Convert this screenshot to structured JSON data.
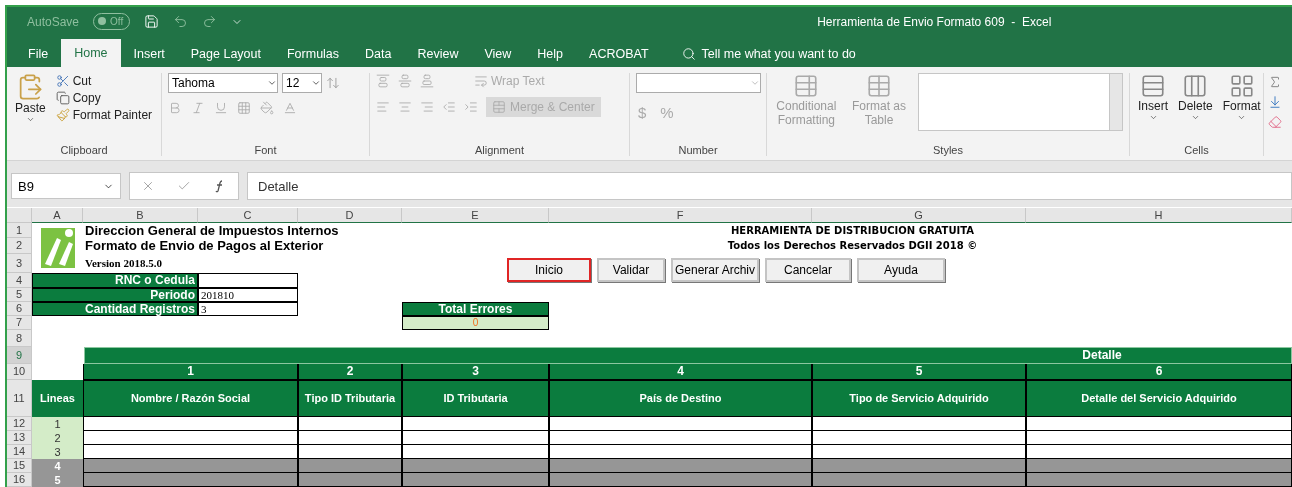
{
  "titlebar": {
    "autosave": {
      "label": "AutoSave",
      "state": "Off",
      "on": false
    },
    "title": "Herramienta de Envio Formato 609  -  Excel"
  },
  "tabs": [
    {
      "label": "File",
      "selected": false
    },
    {
      "label": "Home",
      "selected": true
    },
    {
      "label": "Insert",
      "selected": false
    },
    {
      "label": "Page Layout",
      "selected": false
    },
    {
      "label": "Formulas",
      "selected": false
    },
    {
      "label": "Data",
      "selected": false
    },
    {
      "label": "Review",
      "selected": false
    },
    {
      "label": "View",
      "selected": false
    },
    {
      "label": "Help",
      "selected": false
    },
    {
      "label": "ACROBAT",
      "selected": false
    }
  ],
  "tell_me": "Tell me what you want to do",
  "ribbon": {
    "clipboard": {
      "label": "Clipboard",
      "paste": "Paste",
      "items": [
        {
          "kind": "cut",
          "label": "Cut"
        },
        {
          "kind": "copy",
          "label": "Copy"
        },
        {
          "kind": "painter",
          "label": "Format Painter"
        }
      ]
    },
    "font": {
      "label": "Font",
      "name": "Tahoma",
      "size": "12"
    },
    "alignment": {
      "label": "Alignment",
      "wrap_text": {
        "label": "Wrap Text",
        "disabled": true
      },
      "merge_center": {
        "label": "Merge & Center",
        "disabled": true
      }
    },
    "number": {
      "label": "Number",
      "symbols": [
        "$",
        "%"
      ]
    },
    "styles": {
      "label": "Styles",
      "items": [
        {
          "kind": "conditional",
          "label": "Conditional Formatting",
          "disabled": true
        },
        {
          "kind": "table",
          "label": "Format as Table",
          "disabled": true
        }
      ]
    },
    "cells": {
      "label": "Cells",
      "items": [
        {
          "kind": "insert",
          "label": "Insert"
        },
        {
          "kind": "delete",
          "label": "Delete"
        },
        {
          "kind": "format",
          "label": "Format"
        }
      ]
    }
  },
  "formula_bar": {
    "name_box": "B9",
    "value": "Detalle"
  },
  "column_letters": [
    "A",
    "B",
    "C",
    "D",
    "E",
    "F",
    "G",
    "H"
  ],
  "row_headers": [
    {
      "label": "1",
      "selected": false
    },
    {
      "label": "2",
      "selected": false
    },
    {
      "label": "3",
      "selected": false
    },
    {
      "label": "4",
      "selected": false
    },
    {
      "label": "5",
      "selected": false
    },
    {
      "label": "6",
      "selected": false
    },
    {
      "label": "7",
      "selected": false
    },
    {
      "label": "8",
      "selected": false
    },
    {
      "label": "9",
      "selected": true
    },
    {
      "label": "10",
      "selected": false
    },
    {
      "label": "11",
      "selected": false
    },
    {
      "label": "12",
      "selected": false
    },
    {
      "label": "13",
      "selected": false
    },
    {
      "label": "14",
      "selected": false
    },
    {
      "label": "15",
      "selected": false
    },
    {
      "label": "16",
      "selected": false
    }
  ],
  "sheet": {
    "header_lines": [
      "Direccion General de Impuestos Internos",
      "Formato de Envio de Pagos al Exterior"
    ],
    "version": "Version 2018.5.0",
    "notice": [
      "HERRAMIENTA DE DISTRIBUCION GRATUITA",
      "Todos los Derechos Reservados DGII 2018 ©"
    ],
    "buttons": [
      {
        "label": "Inicio",
        "selected": true
      },
      {
        "label": "Validar",
        "selected": false
      },
      {
        "label": "Generar Archiv",
        "selected": false
      },
      {
        "label": "Cancelar",
        "selected": false
      },
      {
        "label": "Ayuda",
        "selected": false
      }
    ],
    "fields": [
      {
        "label": "RNC o Cedula"
      },
      {
        "label": "Periodo",
        "value": "201810"
      },
      {
        "label": "Cantidad Registros",
        "value": "3"
      }
    ],
    "total_errors": {
      "label": "Total Errores",
      "value": "0"
    },
    "band_title": "Detalle",
    "lines_header": "Lineas",
    "columns": [
      {
        "number": "1",
        "title": "Nombre / Razón Social"
      },
      {
        "number": "2",
        "title": "Tipo ID Tributaria"
      },
      {
        "number": "3",
        "title": "ID Tributaria"
      },
      {
        "number": "4",
        "title": "País de Destino"
      },
      {
        "number": "5",
        "title": "Tipo de Servicio Adquirido"
      },
      {
        "number": "6",
        "title": "Detalle del Servicio Adquirido"
      }
    ],
    "lines": [
      {
        "number": "1",
        "active": true
      },
      {
        "number": "2",
        "active": true
      },
      {
        "number": "3",
        "active": true
      },
      {
        "number": "4",
        "active": false
      },
      {
        "number": "5",
        "active": false
      }
    ]
  }
}
